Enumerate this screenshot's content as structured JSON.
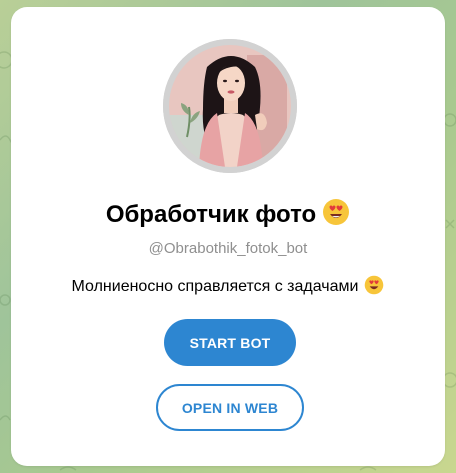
{
  "profile": {
    "title": "Обработчик фото",
    "title_emoji": "heart-eyes-emoji",
    "username": "@Obrabothik_fotok_bot",
    "description": "Молниеносно справляется с задачами",
    "description_emoji": "heart-eyes-emoji"
  },
  "actions": {
    "start_label": "START BOT",
    "web_label": "OPEN IN WEB"
  },
  "colors": {
    "accent": "#2d86d1",
    "card": "#ffffff",
    "username": "#8f8f8f"
  }
}
